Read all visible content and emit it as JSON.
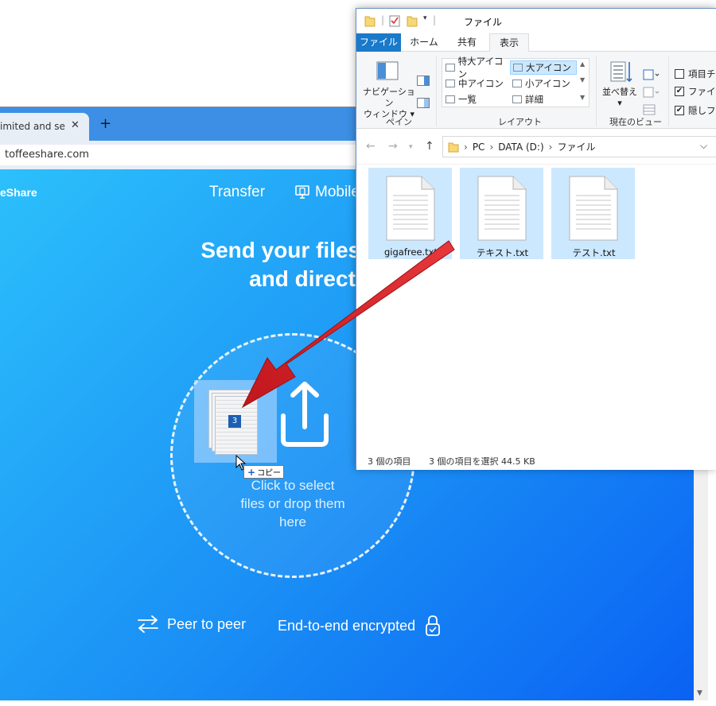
{
  "browser": {
    "tab_title": "imited and secu",
    "tab_close": "✕",
    "new_tab": "+",
    "url": "toffeeshare.com",
    "site": {
      "logo": "eShare",
      "nav_transfer": "Transfer",
      "nav_mobile": "Mobile",
      "hero_line1": "Send your files sec",
      "hero_line2": "and direct",
      "drop_line1": "Click to select",
      "drop_line2": "files or drop them",
      "drop_line3": "here",
      "feature_p2p": "Peer to peer",
      "feature_e2e": "End-to-end encrypted"
    },
    "drag": {
      "badge_count": "3",
      "copy_label": "コピー"
    }
  },
  "explorer": {
    "title": "ファイル",
    "ribbon_tabs": [
      "ファイル",
      "ホーム",
      "共有",
      "表示"
    ],
    "ribbon": {
      "nav_pane_line1": "ナビゲーション",
      "nav_pane_line2": "ウィンドウ",
      "pane_group": "ペイン",
      "layout_items": [
        "特大アイコン",
        "大アイコン",
        "中アイコン",
        "小アイコン",
        "一覧",
        "詳細"
      ],
      "layout_selected": "大アイコン",
      "layout_group": "レイアウト",
      "sort_label": "並べ替え",
      "view_group": "現在のビュー",
      "checks": [
        {
          "label": "項目チ",
          "checked": false
        },
        {
          "label": "ファイル",
          "checked": true
        },
        {
          "label": "隠しファ",
          "checked": true
        }
      ]
    },
    "path": [
      "PC",
      "DATA (D:)",
      "ファイル"
    ],
    "files": [
      "gigafree.txt",
      "テキスト.txt",
      "テスト.txt"
    ],
    "status_count": "3 個の項目",
    "status_selected": "3 個の項目を選択  44.5 KB"
  },
  "colors": {
    "gradient_start": "#2cc0fb",
    "gradient_end": "#0a62f3",
    "explorer_accent": "#1979ca",
    "selection": "#cce8ff",
    "drag_arrow": "#d8262c"
  }
}
